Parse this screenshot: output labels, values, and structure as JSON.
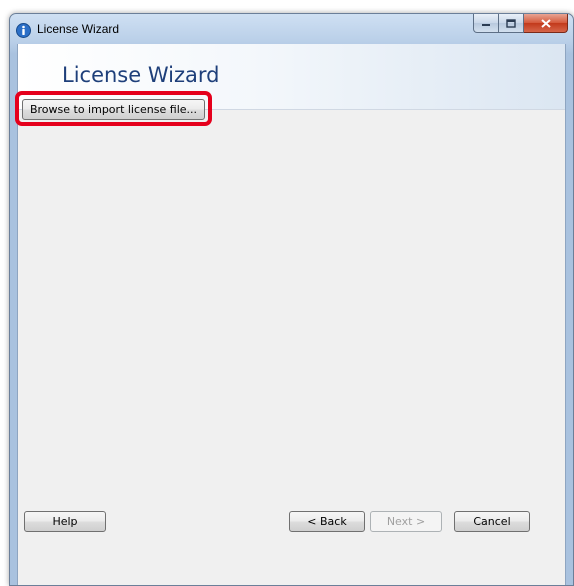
{
  "window": {
    "title": "License Wizard",
    "icon": "info-icon"
  },
  "banner": {
    "title": "License Wizard"
  },
  "content": {
    "browse_label": "Browse to import license file..."
  },
  "footer": {
    "help_label": "Help",
    "back_label": "< Back",
    "next_label": "Next >",
    "cancel_label": "Cancel"
  },
  "annotation": {
    "highlight_color": "#e5001c"
  },
  "colors": {
    "banner_title": "#1e3f7a",
    "close_button": "#c2391b"
  }
}
